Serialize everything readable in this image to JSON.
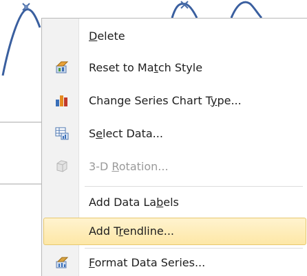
{
  "colors": {
    "series_line": "#3a5f9f",
    "highlight_border": "#e7c86d",
    "menu_text": "#1e1e1e",
    "disabled_text": "#9a9a9a"
  },
  "context_menu": {
    "items": [
      {
        "pre": "",
        "key": "D",
        "post": "elete",
        "icon": "",
        "disabled": false
      },
      {
        "pre": "Reset to Ma",
        "key": "t",
        "post": "ch Style",
        "icon": "reset-style-icon",
        "disabled": false
      },
      {
        "pre": "Change Series Chart T",
        "key": "y",
        "post": "pe...",
        "icon": "change-chart-type-icon",
        "disabled": false
      },
      {
        "pre": "S",
        "key": "e",
        "post": "lect Data...",
        "icon": "select-data-icon",
        "disabled": false
      },
      {
        "pre": "3-D ",
        "key": "R",
        "post": "otation...",
        "icon": "3d-rotation-icon",
        "disabled": true
      },
      {
        "pre": "Add Data La",
        "key": "b",
        "post": "els",
        "icon": "",
        "disabled": false
      },
      {
        "pre": "Add T",
        "key": "r",
        "post": "endline...",
        "icon": "",
        "disabled": false,
        "highlighted": true
      },
      {
        "pre": "",
        "key": "F",
        "post": "ormat Data Series...",
        "icon": "format-data-series-icon",
        "disabled": false
      }
    ]
  }
}
